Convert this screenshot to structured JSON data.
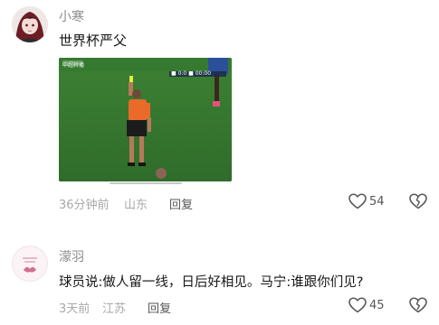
{
  "comments": [
    {
      "username": "小寒",
      "text": "世界杯严父",
      "time": "36分钟前",
      "location": "山东",
      "reply_label": "回复",
      "likes": "54",
      "media": {
        "overlay_left": "中超转播",
        "scoreboard": "■ 0:0 ■ 00:00"
      }
    },
    {
      "username": "濛羽",
      "text": "球员说:做人留一线，日后好相见。马宁:谁跟你们见?",
      "time": "3天前",
      "location": "江苏",
      "reply_label": "回复",
      "likes": "45"
    }
  ],
  "icons": [
    "heart-icon",
    "broken-heart-icon"
  ]
}
